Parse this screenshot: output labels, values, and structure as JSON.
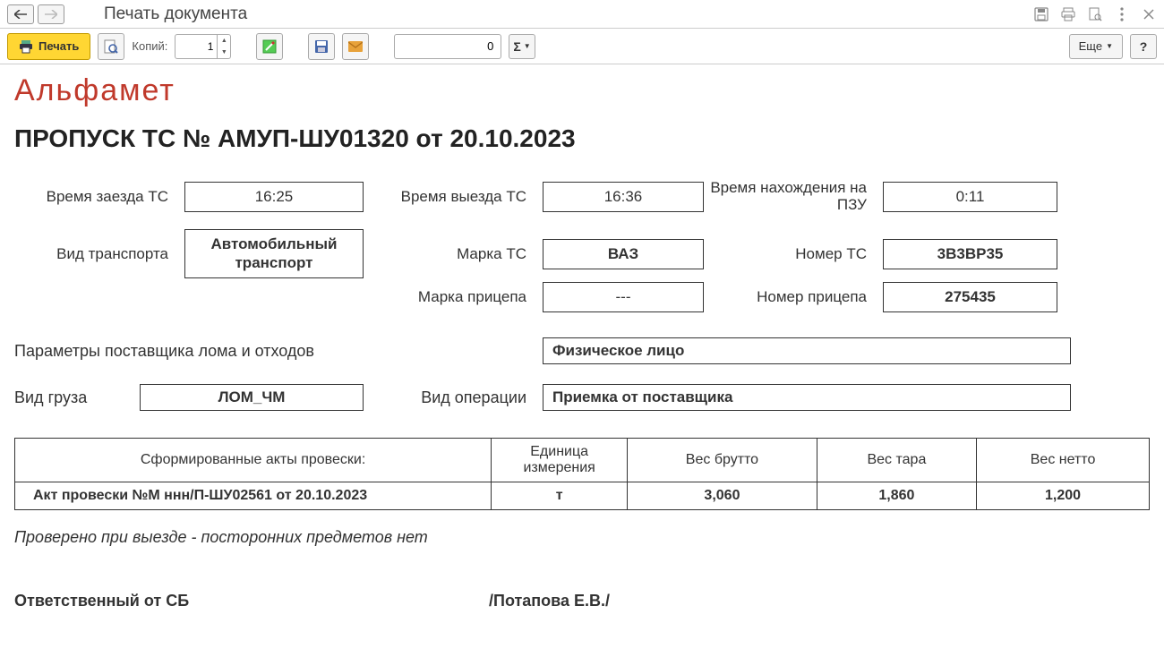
{
  "titlebar": {
    "title": "Печать документа"
  },
  "toolbar": {
    "print_label": "Печать",
    "copies_label": "Копий:",
    "copies_value": "1",
    "sum_value": "0",
    "more_label": "Еще",
    "help_label": "?"
  },
  "doc": {
    "logo": "Альфамет",
    "title": "ПРОПУСК ТС № АМУП-ШУ01320 от 20.10.2023",
    "row1": {
      "label_entry": "Время заезда ТС",
      "value_entry": "16:25",
      "label_exit": "Время выезда ТС",
      "value_exit": "16:36",
      "label_duration": "Время нахождения на ПЗУ",
      "value_duration": "0:11"
    },
    "row2": {
      "label_transport": "Вид транспорта",
      "value_transport": "Автомобильный транспорт",
      "label_brand": "Марка ТС",
      "value_brand": "ВАЗ",
      "label_number": "Номер ТС",
      "value_number": "3В3ВР35"
    },
    "row3": {
      "label_trailer_brand": "Марка прицепа",
      "value_trailer_brand": "---",
      "label_trailer_number": "Номер прицепа",
      "value_trailer_number": "275435"
    },
    "params": {
      "label": "Параметры поставщика лома и отходов",
      "value": "Физическое лицо"
    },
    "cargo": {
      "label_type": "Вид груза",
      "value_type": "ЛОМ_ЧМ",
      "label_operation": "Вид операции",
      "value_operation": "Приемка от поставщика"
    },
    "table": {
      "head": {
        "acts": "Сформированные акты провески:",
        "unit": "Единица измерения",
        "gross": "Вес брутто",
        "tare": "Вес тара",
        "net": "Вес нетто"
      },
      "row": {
        "act": "Акт провески №М ннн/П-ШУ02561 от 20.10.2023",
        "unit": "т",
        "gross": "3,060",
        "tare": "1,860",
        "net": "1,200"
      }
    },
    "checked_note": "Проверено при выезде - посторонних предметов нет",
    "responsible": {
      "label": "Ответственный от СБ",
      "name": "/Потапова Е.В./"
    }
  }
}
